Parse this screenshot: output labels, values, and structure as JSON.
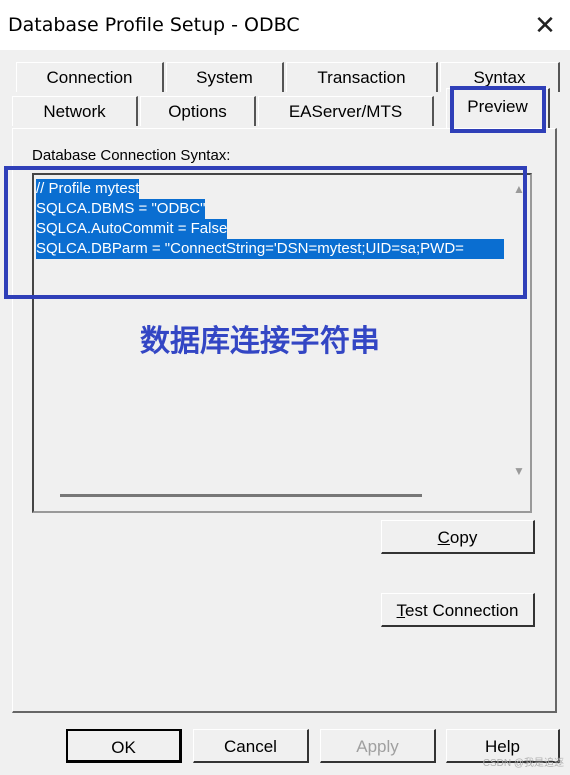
{
  "window": {
    "title": "Database Profile Setup - ODBC"
  },
  "tabs": {
    "row1": [
      {
        "label": "Connection"
      },
      {
        "label": "System"
      },
      {
        "label": "Transaction"
      },
      {
        "label": "Syntax"
      }
    ],
    "row2": [
      {
        "label": "Network"
      },
      {
        "label": "Options"
      },
      {
        "label": "EAServer/MTS"
      },
      {
        "label": "Preview",
        "selected": true
      }
    ]
  },
  "panel": {
    "syntax_label": "Database Connection Syntax:",
    "lines": [
      "// Profile mytest",
      "SQLCA.DBMS = \"ODBC\"",
      "SQLCA.AutoCommit = False",
      "SQLCA.DBParm = \"ConnectString='DSN=mytest;UID=sa;PWD="
    ]
  },
  "annotation": "数据库连接字符串",
  "buttons": {
    "copy_mnemonic": "C",
    "copy_rest": "opy",
    "test_mnemonic": "T",
    "test_rest": "est Connection",
    "ok": "OK",
    "cancel": "Cancel",
    "apply": "Apply",
    "help": "Help"
  },
  "watermark": "CSDN @我是追逐",
  "colors": {
    "highlight_box": "#2f3fb8",
    "selection": "#0a6ed1",
    "annotation": "#3346c4"
  }
}
